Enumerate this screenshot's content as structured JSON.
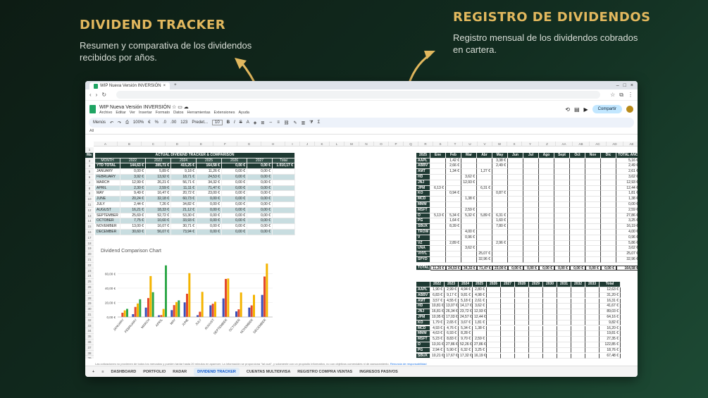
{
  "left_header": {
    "title": "DIVIDEND TRACKER",
    "subtitle_lines": [
      "Resumen y comparativa de los dividendos",
      "recibidos por años."
    ]
  },
  "right_header": {
    "title": "REGISTRO DE DIVIDENDOS",
    "subtitle_lines": [
      "Registro mensual de los dividendos cobrados",
      "en cartera."
    ]
  },
  "browser": {
    "tab_title": "WIP Nueva Versión INVERSIÓN",
    "new_tab": "+"
  },
  "app": {
    "doc_title": "WIP Nueva Versión INVERSIÓN",
    "menus": [
      "Archivo",
      "Editar",
      "Ver",
      "Insertar",
      "Formato",
      "Datos",
      "Herramientas",
      "Extensiones",
      "Ayuda"
    ],
    "share_label": "Compartir",
    "toolbar": {
      "search": "Menús",
      "zoom": "100%",
      "euro": "€",
      "percent": "%",
      "decimals_less": ".0",
      "decimals_more": ".00",
      "number_format": "123",
      "font": "Predet...",
      "font_size": "10"
    },
    "name_box": "All"
  },
  "tracker": {
    "title": "ACTUAL DIVIDEND TRACKER & COMPARISON",
    "headers": [
      "MONTH",
      "2022",
      "2023",
      "2024",
      "2025",
      "2026",
      "2027",
      "Total"
    ],
    "ytd": [
      "YTD TOTAL",
      "144,63 €",
      "285,71 €",
      "415,25 €",
      "164,58 €",
      "0,00 €",
      "0,00 €",
      "1.010,17 €"
    ],
    "rows": [
      [
        "JANUARY",
        "0,00 €",
        "5,89 €",
        "9,18 €",
        "11,26 €",
        "0,00 €",
        "0,00 €"
      ],
      [
        "FEBRUARY",
        "3,92 €",
        "13,92 €",
        "18,71 €",
        "24,53 €",
        "0,00 €",
        "0,00 €"
      ],
      [
        "MARCH",
        "12,99 €",
        "26,21 €",
        "56,71 €",
        "34,32 €",
        "0,00 €",
        "0,00 €"
      ],
      [
        "APRIL",
        "2,30 €",
        "2,59 €",
        "11,11 €",
        "71,47 €",
        "0,00 €",
        "0,00 €"
      ],
      [
        "MAY",
        "9,49 €",
        "16,47 €",
        "20,72 €",
        "23,00 €",
        "0,00 €",
        "0,00 €"
      ],
      [
        "JUNE",
        "20,24 €",
        "32,18 €",
        "60,73 €",
        "0,00 €",
        "0,00 €",
        "0,00 €"
      ],
      [
        "JULY",
        "2,44 €",
        "7,26 €",
        "34,82 €",
        "0,00 €",
        "0,00 €",
        "0,00 €"
      ],
      [
        "AUGUST",
        "16,21 €",
        "18,33 €",
        "21,12 €",
        "0,00 €",
        "0,00 €",
        "0,00 €"
      ],
      [
        "SEPTEMBER",
        "25,69 €",
        "52,72 €",
        "53,30 €",
        "0,00 €",
        "0,00 €",
        "0,00 €"
      ],
      [
        "OCTOBER",
        "7,75 €",
        "10,60 €",
        "33,93 €",
        "0,00 €",
        "0,00 €",
        "0,00 €"
      ],
      [
        "NOVEMBER",
        "13,00 €",
        "16,07 €",
        "30,71 €",
        "0,00 €",
        "0,00 €",
        "0,00 €"
      ],
      [
        "DECEMBER",
        "30,60 €",
        "56,07 €",
        "73,94 €",
        "0,00 €",
        "0,00 €",
        "0,00 €"
      ]
    ]
  },
  "chart_data": {
    "type": "bar",
    "title": "Dividend Comparison Chart",
    "categories": [
      "JANUARY",
      "FEBRUARY",
      "MARCH",
      "APRIL",
      "MAY",
      "JUNE",
      "JULY",
      "AUGUST",
      "SEPTEMBER",
      "OCTOBER",
      "NOVEMBER",
      "DECEMBER"
    ],
    "y_ticks": [
      "0,00 €",
      "20,00 €",
      "40,00 €",
      "60,00 €"
    ],
    "ylim": [
      0,
      80
    ],
    "series": [
      {
        "values": [
          0,
          3.92,
          12.99,
          2.3,
          9.49,
          20.24,
          2.44,
          16.21,
          25.69,
          7.75,
          13.0,
          30.6
        ],
        "color": "#3b4fb8"
      },
      {
        "values": [
          5.89,
          13.92,
          26.21,
          2.59,
          16.47,
          32.18,
          7.26,
          18.33,
          52.72,
          10.6,
          16.07,
          56.07
        ],
        "color": "#e34a2f"
      },
      {
        "values": [
          9.18,
          18.71,
          56.71,
          11.11,
          20.72,
          60.73,
          34.82,
          21.12,
          53.3,
          33.93,
          30.71,
          73.94
        ],
        "color": "#f4b400"
      },
      {
        "values": [
          11.26,
          24.53,
          34.32,
          71.47,
          23.0,
          0,
          0,
          0,
          0,
          0,
          0,
          0
        ],
        "color": "#30a84a"
      }
    ],
    "grid": true
  },
  "registro": {
    "headers": [
      "2025",
      "Ene",
      "Feb",
      "Mar",
      "Abr",
      "May",
      "Jun",
      "Jul",
      "Ago",
      "Sept",
      "Oct",
      "Nov",
      "Dic",
      "TOTAL AÑO"
    ],
    "tickers": [
      "AAPL",
      "ABBV",
      "AMT",
      "HD",
      "JNJ",
      "JPM",
      "KO",
      "MCD",
      "MMM",
      "MSFT",
      "O",
      "PG",
      "SBUX",
      "TROW",
      "V",
      "VZ",
      "UNA",
      "VHYL",
      "SPYD"
    ],
    "totals_label": "TOTAL",
    "year_totals": [
      "5,16 €",
      "2,49 €",
      "2,61 €",
      "3,62 €",
      "12,93 €",
      "12,44 €",
      "1,81 €",
      "1,38 €",
      "0,00 €",
      "2,59 €",
      "27,86 €",
      "3,25 €",
      "16,19 €",
      "4,00 €",
      "0,96 €",
      "5,86 €",
      "3,62 €",
      "25,07 €",
      "32,96 €"
    ],
    "totals_row": [
      "11,26 €",
      "24,53 €",
      "34,32 €",
      "71,47 €",
      "23,00 €",
      "0,00 €",
      "0,00 €",
      "0,00 €",
      "0,00 €",
      "0,00 €",
      "0,00 €",
      "0,00 €",
      "164,58 €"
    ]
  },
  "compare_table": {
    "headers": [
      "2022",
      "2023",
      "2024",
      "2025",
      "2026",
      "2027",
      "2028",
      "2029",
      "2030",
      "2031",
      "2032",
      "2033",
      "Total"
    ],
    "rows": [
      [
        "AAPL",
        "1,90 €",
        "2,99 €",
        "4,94 €",
        "2,80 €",
        "12,63 €"
      ],
      [
        "ABBV",
        "6,83 €",
        "9,17 €",
        "9,81 €",
        "4,98 €",
        "31,20 €"
      ],
      [
        "AMT",
        "3,57 €",
        "4,55 €",
        "5,18 €",
        "2,61 €",
        "16,31 €"
      ],
      [
        "HD",
        "10,81 €",
        "13,07 €",
        "14,17 €",
        "3,62 €",
        "41,67 €"
      ],
      [
        "JNJ",
        "16,81 €",
        "26,34 €",
        "23,72 €",
        "12,93 €",
        "89,03 €"
      ],
      [
        "JPM",
        "10,95 €",
        "17,03 €",
        "24,57 €",
        "12,44 €",
        "64,16 €"
      ],
      [
        "KO",
        "1,79 €",
        "2,65 €",
        "3,67 €",
        "1,81 €",
        "9,82 €"
      ],
      [
        "MCD",
        "4,93 €",
        "4,76 €",
        "5,34 €",
        "1,38 €",
        "16,20 €"
      ],
      [
        "MMM",
        "4,63 €",
        "6,93 €",
        "8,28 €",
        "",
        "19,81 €"
      ],
      [
        "MSFT",
        "5,23 €",
        "8,83 €",
        "9,70 €",
        "2,59 €",
        "27,35 €"
      ],
      [
        "O",
        "13,91 €",
        "27,86 €",
        "52,26 €",
        "27,86 €",
        "122,85 €"
      ],
      [
        "PG",
        "2,94 €",
        "5,90 €",
        "6,32 €",
        "3,25 €",
        "18,76 €"
      ],
      [
        "SBUX",
        "10,21 €",
        "17,67 €",
        "17,32 €",
        "16,19 €",
        "67,48 €"
      ]
    ]
  },
  "side_table": {
    "headers": [
      "Ene",
      "Feb",
      "Ma"
    ],
    "rows": [
      [
        "AAPL",
        "",
        "0,76 €"
      ],
      [
        "ABBV",
        "",
        "2,48 €"
      ],
      [
        "AMT",
        "",
        "1,34 €"
      ],
      [
        "HD",
        "",
        ""
      ],
      [
        "JNJ",
        "",
        ""
      ],
      [
        "JPM",
        "4,93 €",
        ""
      ],
      [
        "KO",
        "",
        "0,87 €"
      ],
      [
        "MCD",
        "",
        ""
      ],
      [
        "MMM",
        "",
        ""
      ],
      [
        "MSFT",
        "",
        ""
      ],
      [
        "O",
        "4,20 €",
        "4,31 €"
      ],
      [
        "PG",
        "",
        "1,84 €"
      ],
      [
        "SBUX",
        "",
        ""
      ],
      [
        "TROW",
        "",
        ""
      ],
      [
        "V",
        "",
        "0,82 €"
      ],
      [
        "VZ",
        "",
        "2,64 €"
      ],
      [
        "UNA",
        "",
        ""
      ],
      [
        "VHYL",
        "",
        ""
      ],
      [
        "SPYD",
        "",
        ""
      ]
    ],
    "total": [
      "TOTAL",
      "9,13 €",
      "18,71 €"
    ]
  },
  "sheet_tabs": [
    "DASHBOARD",
    "PORTFOLIO",
    "RADAR",
    "DIVIDEND TRACKER",
    "CUENTAS MULTIDIVISA",
    "REGISTRO COMPRA VENTAS",
    "INGRESOS PASIVOS"
  ],
  "active_tab": "DIVIDEND TRACKER",
  "footnote": "Las cotizaciones no provienen de todos los mercados y pueden tardar hasta 20 minutos en aparecer. La información se proporciona \"tal cual\", y solamente con un propósito informativo, no con objetivos comerciales ni de asesoramiento.",
  "footnote_link": "Renuncia de responsabilidad"
}
